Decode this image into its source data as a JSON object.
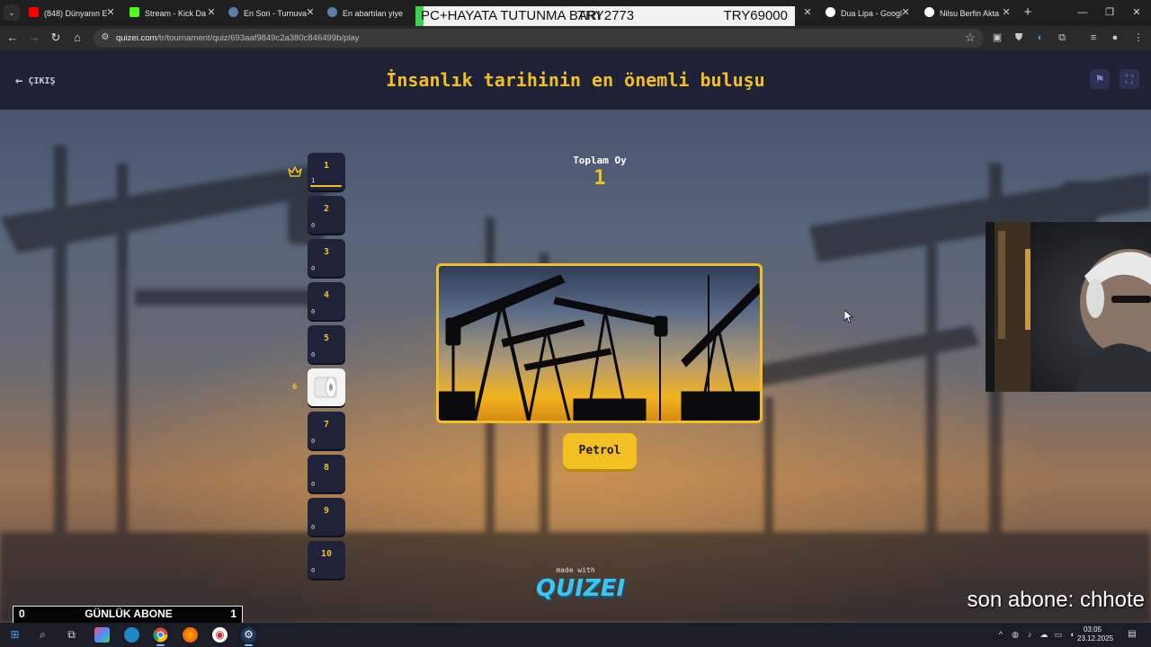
{
  "browser": {
    "tabs": [
      {
        "title": "(848) Dünyanın E",
        "favicon": "youtube-icon",
        "color": "#ff0000"
      },
      {
        "title": "Stream - Kick Da",
        "favicon": "kick-icon",
        "color": "#53fc18"
      },
      {
        "title": "En Son - Turnuva",
        "favicon": "quizei-icon",
        "color": "#5a7fa8"
      },
      {
        "title": "En abartılan yiye",
        "favicon": "quizei-icon",
        "color": "#5a7fa8"
      },
      {
        "title": "Dua Lipa - Googl",
        "favicon": "google-icon",
        "color": "#ffffff"
      },
      {
        "title": "Nilsu Berfin Akta",
        "favicon": "google-icon",
        "color": "#ffffff"
      }
    ],
    "url_host": "quizei.com",
    "url_path": "/tr/tournament/quiz/693aaf9849c2a380c846499b/play"
  },
  "overlay": {
    "donation_label": "PC+HAYATA TUTUNMA BARI",
    "donation_mid": "TRY2773",
    "donation_goal": "TRY69000",
    "daily_left": "0",
    "daily_label": "GÜNLÜK ABONE",
    "daily_right": "1",
    "last_sub": "son abone: chhote"
  },
  "quiz": {
    "exit_label": "ÇIKIŞ",
    "title": "İnsanlık tarihinin en önemli buluşu",
    "total_votes_label": "Toplam Oy",
    "total_votes_value": "1",
    "answer_label": "Petrol",
    "made_with": "made with",
    "logo": "QUIZEI",
    "side_marker": "6",
    "rounds": [
      {
        "num": "1",
        "count": "1",
        "leader": true
      },
      {
        "num": "2",
        "count": "0"
      },
      {
        "num": "3",
        "count": "0"
      },
      {
        "num": "4",
        "count": "0"
      },
      {
        "num": "5",
        "count": "0"
      },
      {
        "num": "6",
        "count": "",
        "active": true
      },
      {
        "num": "7",
        "count": "0"
      },
      {
        "num": "8",
        "count": "0"
      },
      {
        "num": "9",
        "count": "0"
      },
      {
        "num": "10",
        "count": "0"
      }
    ]
  },
  "taskbar": {
    "time": "03:05",
    "date": "23.12.2025"
  },
  "colors": {
    "accent": "#f2c023",
    "header_bg": "#1f2137",
    "logo": "#3fc4ee"
  }
}
